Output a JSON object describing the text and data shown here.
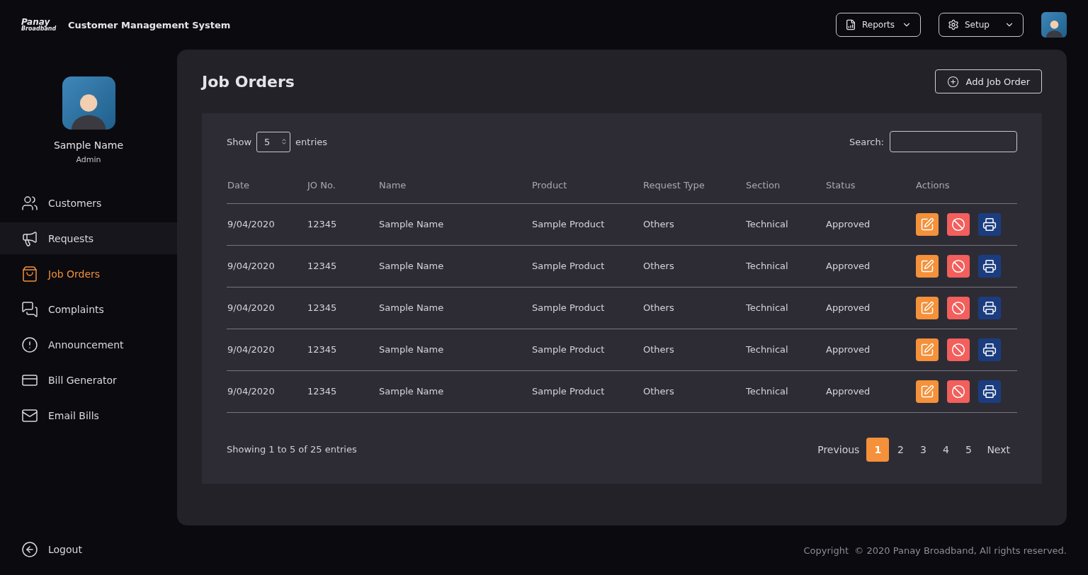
{
  "header": {
    "logo": {
      "line_1": "Panay",
      "line_2": "Broadband"
    },
    "title": "Customer Management System",
    "menus": [
      {
        "kind": "reports",
        "label": "Reports"
      },
      {
        "kind": "setup",
        "label": "Setup"
      }
    ]
  },
  "profile": {
    "name": "Sample Name",
    "role": "Admin"
  },
  "sidebar": {
    "items": [
      {
        "kind": "customers",
        "label": "Customers",
        "selected": false,
        "hovered": false
      },
      {
        "kind": "requests",
        "label": "Requests",
        "selected": false,
        "hovered": true
      },
      {
        "kind": "job_orders",
        "label": "Job Orders",
        "selected": true,
        "hovered": false
      },
      {
        "kind": "complaints",
        "label": "Complaints",
        "selected": false,
        "hovered": false
      },
      {
        "kind": "announcement",
        "label": "Announcement",
        "selected": false,
        "hovered": false
      },
      {
        "kind": "bill",
        "label": "Bill Generator",
        "selected": false,
        "hovered": false
      },
      {
        "kind": "email",
        "label": "Email Bills",
        "selected": false,
        "hovered": false
      }
    ],
    "logout": "Logout"
  },
  "page": {
    "title": "Job Orders",
    "add_button": "Add Job Order"
  },
  "table": {
    "show_label": "Show",
    "page_size": "5",
    "entries_label": "entries",
    "search_label": "Search:",
    "columns": [
      "Date",
      "JO No.",
      "Name",
      "Product",
      "Request Type",
      "Section",
      "Status",
      "Actions"
    ],
    "rows": [
      {
        "cells": [
          "9/04/2020",
          "12345",
          "Sample Name",
          "Sample Product",
          "Others",
          "Technical",
          "Approved"
        ],
        "actions": [
          {
            "kind": "edit"
          },
          {
            "kind": "cancel"
          },
          {
            "kind": "print"
          }
        ]
      },
      {
        "cells": [
          "9/04/2020",
          "12345",
          "Sample Name",
          "Sample Product",
          "Others",
          "Technical",
          "Approved"
        ],
        "actions": [
          {
            "kind": "edit"
          },
          {
            "kind": "cancel"
          },
          {
            "kind": "print"
          }
        ]
      },
      {
        "cells": [
          "9/04/2020",
          "12345",
          "Sample Name",
          "Sample Product",
          "Others",
          "Technical",
          "Approved"
        ],
        "actions": [
          {
            "kind": "edit"
          },
          {
            "kind": "cancel"
          },
          {
            "kind": "print"
          }
        ]
      },
      {
        "cells": [
          "9/04/2020",
          "12345",
          "Sample Name",
          "Sample Product",
          "Others",
          "Technical",
          "Approved"
        ],
        "actions": [
          {
            "kind": "edit"
          },
          {
            "kind": "cancel"
          },
          {
            "kind": "print"
          }
        ]
      },
      {
        "cells": [
          "9/04/2020",
          "12345",
          "Sample Name",
          "Sample Product",
          "Others",
          "Technical",
          "Approved"
        ],
        "actions": [
          {
            "kind": "edit"
          },
          {
            "kind": "cancel"
          },
          {
            "kind": "print"
          }
        ]
      }
    ],
    "info": "Showing 1 to 5 of 25 entries",
    "pagination": {
      "previous": "Previous",
      "next": "Next",
      "pages": [
        {
          "label": "1",
          "selected": true
        },
        {
          "label": "2",
          "selected": false
        },
        {
          "label": "3",
          "selected": false
        },
        {
          "label": "4",
          "selected": false
        },
        {
          "label": "5",
          "selected": false
        }
      ]
    }
  },
  "footer": {
    "copyright": "Copyright  © 2020 Panay Broadband, All rights reserved."
  }
}
